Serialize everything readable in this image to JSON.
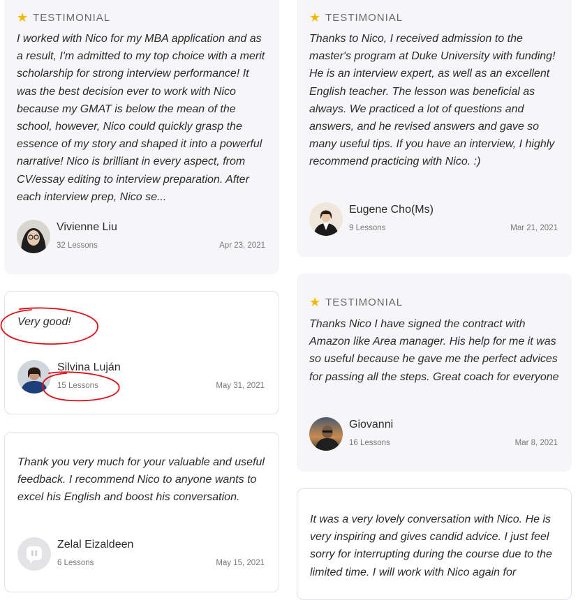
{
  "tag_label": "TESTIMONIAL",
  "cards": [
    {
      "quote": "I worked with Nico for my MBA application and as a result, I'm admitted to my top choice with a merit scholarship for strong interview performance! It was the best decision ever to work with Nico because my GMAT is below the mean of the school, however, Nico could quickly grasp the essence of my story and shaped it into a powerful narrative! Nico is brilliant in every aspect, from CV/essay editing to interview preparation. After each interview prep, Nico se...",
      "name": "Vivienne Liu",
      "lessons": "32 Lessons",
      "date": "Apr 23, 2021"
    },
    {
      "quote": "Very good!",
      "name": "Silvina Luján",
      "lessons": "15 Lessons",
      "date": "May 31, 2021"
    },
    {
      "quote": "Thank you very much for your valuable and useful feedback. I recommend Nico to anyone wants to excel his English and boost his conversation.",
      "name": "Zelal Eizaldeen",
      "lessons": "6 Lessons",
      "date": "May 15, 2021"
    },
    {
      "quote": "Thanks to Nico, I received admission to the master's program at Duke University with funding! He is an interview expert, as well as an excellent English teacher. The lesson was beneficial as always. We practiced a lot of questions and answers, and he revised answers and gave so many useful tips. If you have an interview, I highly recommend practicing with Nico. :)",
      "name": "Eugene Cho(Ms)",
      "lessons": "9 Lessons",
      "date": "Mar 21, 2021"
    },
    {
      "quote": "Thanks Nico I have signed the contract with Amazon like Area manager. His help for me it was so useful because he gave me the perfect advices for passing all the steps. Great coach for everyone",
      "name": "Giovanni",
      "lessons": "16 Lessons",
      "date": "Mar 8, 2021"
    },
    {
      "quote": "It was a very lovely conversation with Nico. He is very inspiring and gives candid advice. I just feel sorry for interrupting during the course due to the limited time. I will work with Nico again for"
    }
  ],
  "colors": {
    "star": "#f5b800",
    "card_shaded": "#f6f6f8",
    "annotation": "#e0101a"
  }
}
